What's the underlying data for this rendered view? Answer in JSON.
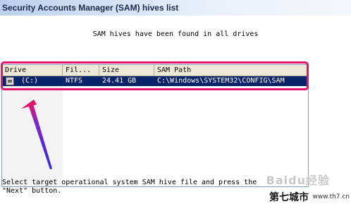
{
  "window": {
    "title": "Security Accounts Manager (SAM) hives list"
  },
  "message": "SAM hives have been found in all drives",
  "list": {
    "columns": [
      "Drive",
      "Fil...",
      "Size",
      "SAM Path"
    ],
    "rows": [
      {
        "drive": "(C:)",
        "filesystem": "NTFS",
        "size": "24.41 GB",
        "path": "C:\\Windows\\SYSTEM32\\CONFIG\\SAM",
        "icon": "hard-drive-icon",
        "selected": true
      }
    ]
  },
  "instruction": "Select target operational system SAM hive file and press the \"Next\" button.",
  "annotation": {
    "highlight_color": "#e4136b",
    "arrow_color": "#3a2bd1"
  },
  "watermark": {
    "top_text": "Baidu经验",
    "site_text": "第七城市",
    "url_text": "www.th7.cn"
  }
}
